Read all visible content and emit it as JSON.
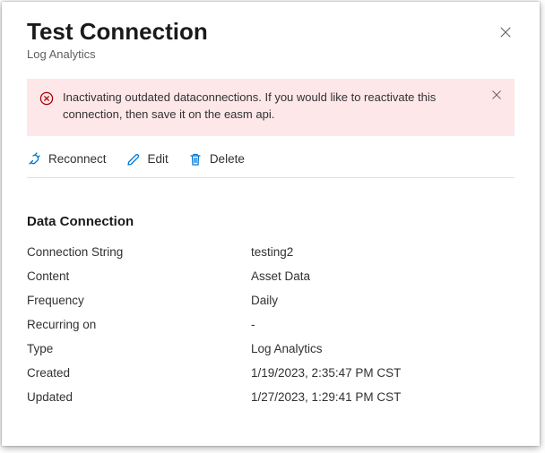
{
  "header": {
    "title": "Test Connection",
    "subtitle": "Log Analytics"
  },
  "alert": {
    "text": "Inactivating outdated dataconnections. If you would like to reactivate this connection, then save it on the easm api."
  },
  "toolbar": {
    "reconnect_label": "Reconnect",
    "edit_label": "Edit",
    "delete_label": "Delete"
  },
  "section": {
    "title": "Data Connection"
  },
  "fields": {
    "connection_string": {
      "label": "Connection String",
      "value": "testing2"
    },
    "content": {
      "label": "Content",
      "value": "Asset Data"
    },
    "frequency": {
      "label": "Frequency",
      "value": "Daily"
    },
    "recurring_on": {
      "label": "Recurring on",
      "value": "-"
    },
    "type": {
      "label": "Type",
      "value": "Log Analytics"
    },
    "created": {
      "label": "Created",
      "value": "1/19/2023, 2:35:47 PM CST"
    },
    "updated": {
      "label": "Updated",
      "value": "1/27/2023, 1:29:41 PM CST"
    }
  }
}
